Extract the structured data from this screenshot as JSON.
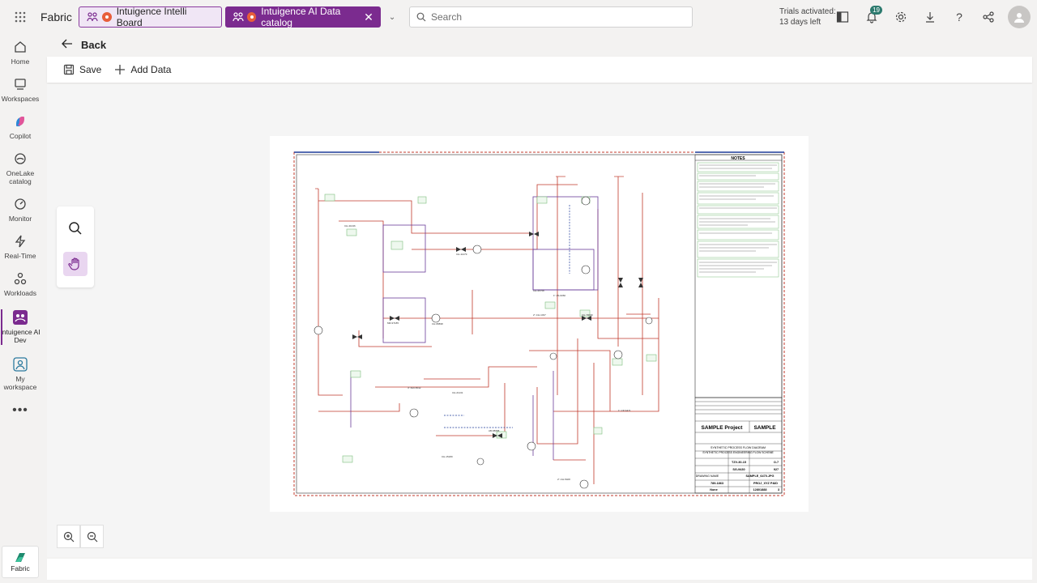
{
  "app": {
    "brand": "Fabric"
  },
  "tabs": [
    {
      "label": "Intuigence Intelli Board",
      "active": false
    },
    {
      "label": "Intuigence AI Data catalog",
      "active": true
    }
  ],
  "search": {
    "placeholder": "Search"
  },
  "trial": {
    "line1": "Trials activated:",
    "line2": "13 days left"
  },
  "notifications": {
    "count": "19"
  },
  "rail": [
    {
      "label": "Home",
      "icon": "home-icon"
    },
    {
      "label": "Workspaces",
      "icon": "workspaces-icon"
    },
    {
      "label": "Copilot",
      "icon": "copilot-icon"
    },
    {
      "label": "OneLake catalog",
      "icon": "onelake-icon"
    },
    {
      "label": "Monitor",
      "icon": "monitor-icon"
    },
    {
      "label": "Real-Time",
      "icon": "realtime-icon"
    },
    {
      "label": "Workloads",
      "icon": "workloads-icon"
    },
    {
      "label": "Intuigence AI Dev",
      "icon": "intuigence-icon"
    },
    {
      "label": "My workspace",
      "icon": "my-workspace-icon"
    }
  ],
  "rail_footer": {
    "label": "Fabric"
  },
  "back": {
    "label": "Back"
  },
  "toolbar": {
    "save_label": "Save",
    "add_data_label": "Add Data"
  },
  "drawing": {
    "notes_title": "NOTES",
    "project": "SAMPLE Project",
    "sample": "SAMPLE",
    "diagram_title": "SYNTHETIC PROCESS FLOW DIAGRAM",
    "diagram_subtitle": "SYNTHETIC PROCESS ENGINEERING FLOW SCHEME",
    "drawing_name_label": "DRAWING NAME",
    "drawing_name": "SAMPLE_6470.JPG",
    "project_code": "TZV-30-15",
    "contract_no": "SG-9430",
    "org_code": "O-7",
    "contract_code": "927",
    "unit": "789-1863",
    "contract_name": "PROJ_XYZ P&ID",
    "scale": "None",
    "drawing_no": "12801888",
    "rev": "3"
  },
  "colors": {
    "accent": "#7b2b8f",
    "pipe_red": "#c0392b",
    "pipe_purple": "#6a3d9a",
    "tag_green": "#7fbf7f"
  }
}
